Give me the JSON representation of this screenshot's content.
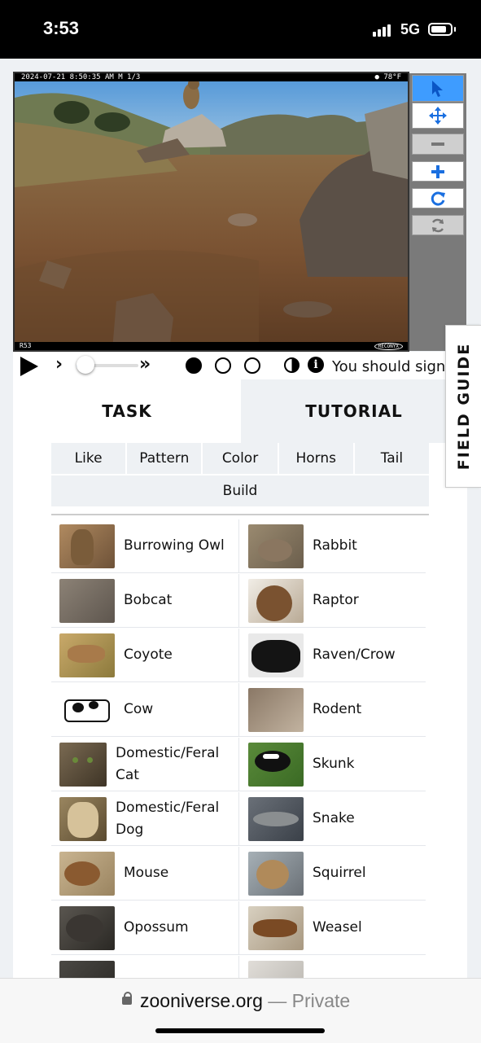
{
  "status_bar": {
    "time": "3:53",
    "network": "5G"
  },
  "camera": {
    "header_left": "2024-07-21  8:50:35 AM  M 1/3",
    "header_right": "● 78°F",
    "footer_left": "R53",
    "footer_right": "RECONYX"
  },
  "toolbar": {
    "items": [
      {
        "name": "select-tool",
        "icon": "cursor-arrow-icon",
        "state": "selected"
      },
      {
        "name": "pan-tool",
        "icon": "move-arrows-icon",
        "state": "normal"
      },
      {
        "name": "zoom-out",
        "icon": "minus-icon",
        "state": "disabled"
      },
      {
        "name": "zoom-in",
        "icon": "plus-icon",
        "state": "normal"
      },
      {
        "name": "rotate",
        "icon": "rotate-icon",
        "state": "normal"
      },
      {
        "name": "reset",
        "icon": "refresh-icon",
        "state": "disabled"
      }
    ]
  },
  "playback": {
    "progress": 0.15,
    "frames": 3,
    "current_frame": 1,
    "sign_in_text": "You should sign"
  },
  "tabs": {
    "task": "TASK",
    "tutorial": "TUTORIAL"
  },
  "filters": {
    "row1": [
      "Like",
      "Pattern",
      "Color",
      "Horns",
      "Tail"
    ],
    "row2": [
      "Build"
    ]
  },
  "species": [
    {
      "left": "Burrowing Owl",
      "right": "Rabbit"
    },
    {
      "left": "Bobcat",
      "right": "Raptor"
    },
    {
      "left": "Coyote",
      "right": "Raven/Crow"
    },
    {
      "left": "Cow",
      "right": "Rodent"
    },
    {
      "left": "Domestic/Feral Cat",
      "right": "Skunk"
    },
    {
      "left": "Domestic/Feral Dog",
      "right": "Snake"
    },
    {
      "left": "Mouse",
      "right": "Squirrel"
    },
    {
      "left": "Opossum",
      "right": "Weasel"
    },
    {
      "left": "",
      "right": ""
    }
  ],
  "field_guide": "FIELD GUIDE",
  "browser": {
    "domain": "zooniverse.org",
    "separator": " — ",
    "mode": "Private"
  },
  "colors": {
    "accent": "#1a6fe0",
    "selected_tool": "#3e9cff",
    "tab_inactive": "#eef1f4"
  }
}
